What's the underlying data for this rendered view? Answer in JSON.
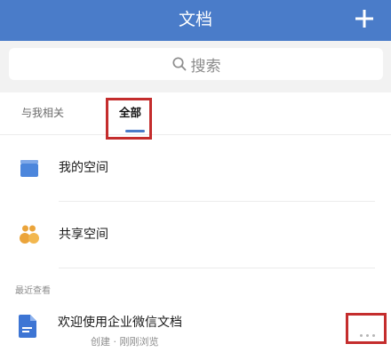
{
  "header": {
    "title": "文档",
    "add_icon": "plus-icon"
  },
  "search": {
    "placeholder": "搜索",
    "icon": "search-icon"
  },
  "tabs": [
    {
      "label": "与我相关",
      "active": false
    },
    {
      "label": "全部",
      "active": true
    }
  ],
  "spaces": [
    {
      "label": "我的空间",
      "icon": "folder-icon"
    },
    {
      "label": "共享空间",
      "icon": "people-icon"
    }
  ],
  "recent": {
    "section_label": "最近查看",
    "items": [
      {
        "title": "欢迎使用企业微信文档",
        "meta": "创建 · 刚刚浏览",
        "icon": "document-icon"
      }
    ]
  },
  "colors": {
    "header_bg": "#4a7cc9",
    "accent": "#4a7cc9",
    "folder": "#4c86dc",
    "people": "#eba43a",
    "highlight": "#c42d2d"
  }
}
